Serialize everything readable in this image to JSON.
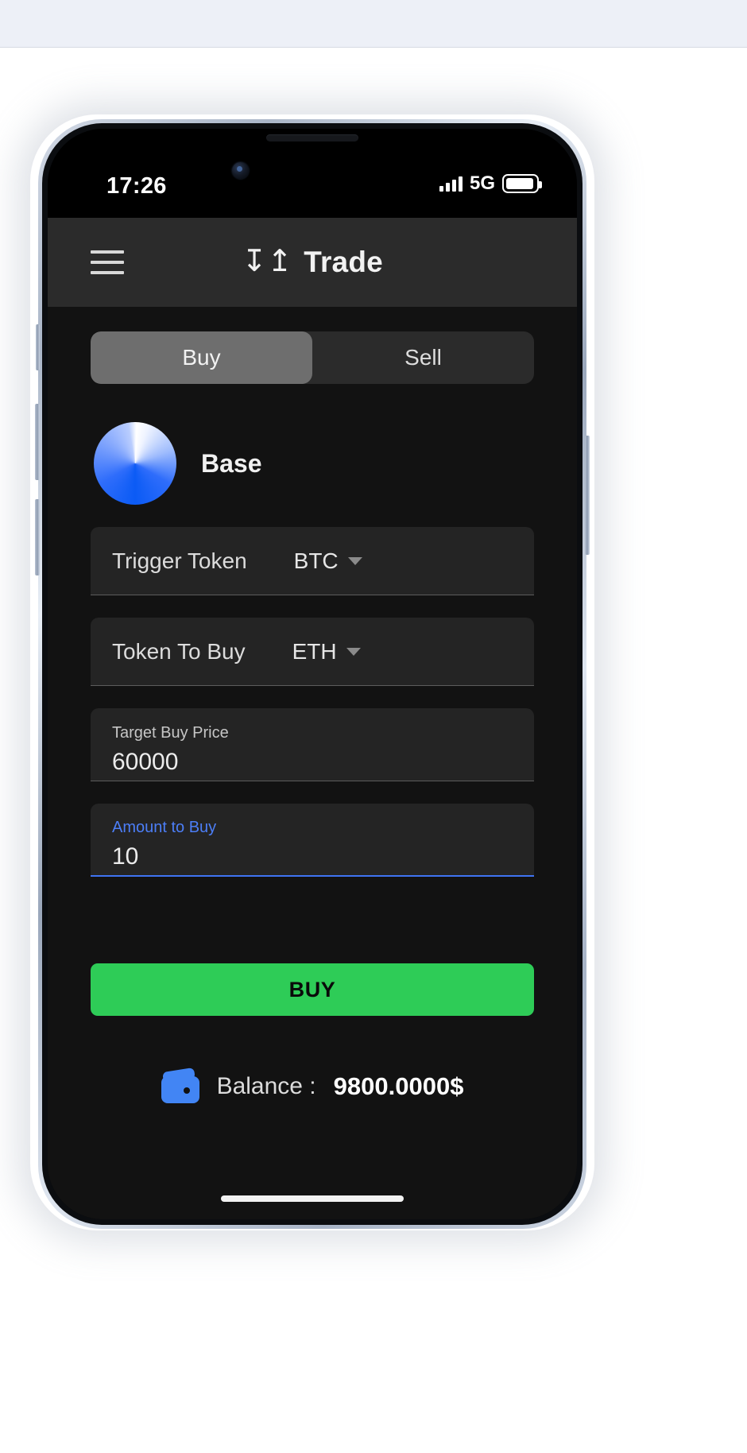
{
  "status_bar": {
    "time": "17:26",
    "network": "5G",
    "signal_icon": "signal-bars-icon",
    "battery_icon": "battery-full-icon"
  },
  "app_bar": {
    "menu_icon": "hamburger-menu-icon",
    "title_icon": "trade-arrows-icon",
    "title_glyph": "↧↥",
    "title": "Trade"
  },
  "segmented_control": {
    "options": [
      {
        "label": "Buy",
        "selected": true
      },
      {
        "label": "Sell",
        "selected": false
      }
    ]
  },
  "token": {
    "logo_icon": "base-token-logo-icon",
    "name": "Base"
  },
  "fields": {
    "trigger_token": {
      "label": "Trigger Token",
      "value": "BTC",
      "caret_icon": "chevron-down-icon"
    },
    "token_to_buy": {
      "label": "Token To Buy",
      "value": "ETH",
      "caret_icon": "chevron-down-icon"
    },
    "target_buy_price": {
      "label": "Target Buy Price",
      "value": "60000",
      "focused": false
    },
    "amount_to_buy": {
      "label": "Amount to Buy",
      "value": "10",
      "focused": true
    }
  },
  "actions": {
    "buy_label": "BUY"
  },
  "balance": {
    "wallet_icon": "wallet-icon",
    "label": "Balance :",
    "value": "9800.0000$"
  },
  "colors": {
    "accent_blue": "#4c7ef7",
    "buy_green": "#2ecc57",
    "app_bar": "#2b2b2b",
    "app_background": "#121212",
    "field_background": "#242424",
    "segment_active": "#6e6e6e"
  }
}
